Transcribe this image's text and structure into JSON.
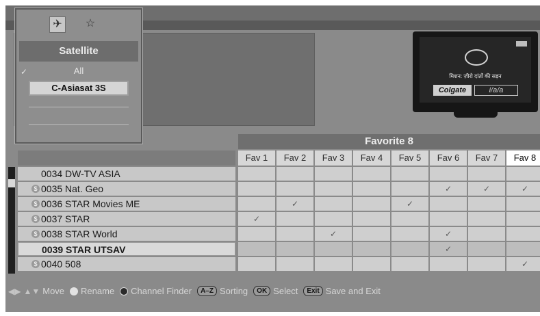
{
  "popup": {
    "title": "Satellite",
    "all_label": "All",
    "selected_satellite": "C-Asiasat 3S",
    "icons": [
      "satellite-icon",
      "star-icon"
    ]
  },
  "tv_preview": {
    "caption": "मिशन: ज़ीरो दांतों की सड़न",
    "brand": "Colgate",
    "brand_tail": "i/a/a"
  },
  "favorites": {
    "group_title": "Favorite 8",
    "columns": [
      "Fav 1",
      "Fav 2",
      "Fav 3",
      "Fav 4",
      "Fav 5",
      "Fav 6",
      "Fav 7",
      "Fav 8"
    ],
    "active_column": "Fav 8"
  },
  "channels": [
    {
      "label": "0034 DW-TV ASIA",
      "scrambled": false,
      "checks": [
        false,
        false,
        false,
        false,
        false,
        false,
        false,
        false
      ]
    },
    {
      "label": "0035 Nat. Geo",
      "scrambled": true,
      "checks": [
        false,
        false,
        false,
        false,
        false,
        true,
        true,
        true
      ]
    },
    {
      "label": "0036 STAR Movies ME",
      "scrambled": true,
      "checks": [
        false,
        true,
        false,
        false,
        true,
        false,
        false,
        false
      ]
    },
    {
      "label": "0037 STAR",
      "scrambled": true,
      "checks": [
        true,
        false,
        false,
        false,
        false,
        false,
        false,
        false
      ]
    },
    {
      "label": "0038 STAR World",
      "scrambled": true,
      "checks": [
        false,
        false,
        true,
        false,
        false,
        true,
        false,
        false
      ]
    },
    {
      "label": "0039 STAR UTSAV",
      "scrambled": false,
      "selected": true,
      "checks": [
        false,
        false,
        false,
        false,
        false,
        true,
        false,
        false
      ]
    },
    {
      "label": "0040 508",
      "scrambled": true,
      "checks": [
        false,
        false,
        false,
        false,
        false,
        false,
        false,
        true
      ]
    }
  ],
  "help": {
    "move": "Move",
    "rename": "Rename",
    "channel_finder": "Channel Finder",
    "az_key": "A–Z",
    "sorting": "Sorting",
    "ok_key": "OK",
    "select": "Select",
    "exit_key": "Exit",
    "save_exit": "Save and Exit"
  },
  "colors": {
    "background": "#8a8a8a",
    "row": "#c8c8c8",
    "active_header": "#ffffff"
  }
}
